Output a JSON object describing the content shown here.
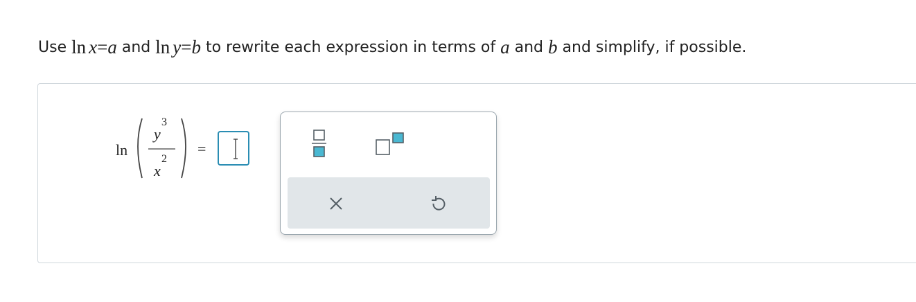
{
  "instruction": {
    "use": "Use",
    "ln1": "ln",
    "x": "x",
    "eq1": "=",
    "a": "a",
    "and1": "and",
    "ln2": "ln",
    "y": "y",
    "eq2": "=",
    "b": "b",
    "rest1": "to rewrite each expression in terms of",
    "a2": "a",
    "and2": "and",
    "b2": "b",
    "rest2": "and simplify, if possible."
  },
  "expression": {
    "fn": "ln",
    "num_base": "y",
    "num_exp": "3",
    "den_base": "x",
    "den_exp": "2",
    "equals": "="
  },
  "answer": {
    "value": ""
  },
  "toolbox": {
    "buttons": [
      "fraction-template",
      "exponent-template"
    ],
    "actions": [
      "clear",
      "undo"
    ]
  },
  "colors": {
    "accent": "#2a8db3",
    "template_fill": "#4ab8d2",
    "icon_gray": "#555f66",
    "action_bar": "#e1e6e9"
  }
}
